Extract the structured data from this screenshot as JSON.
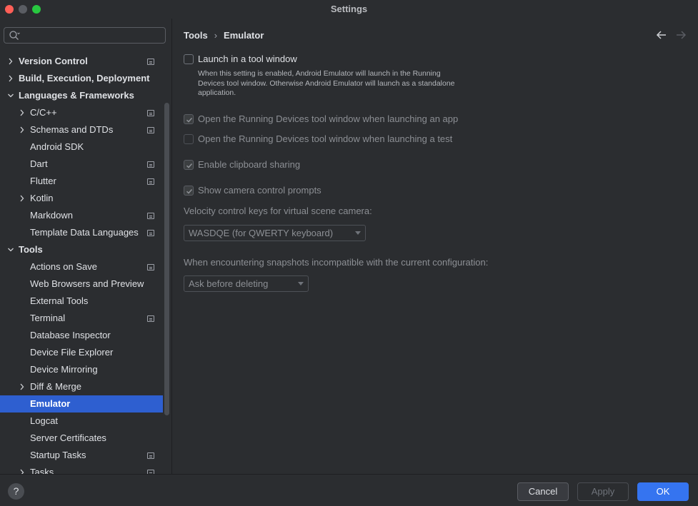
{
  "window": {
    "title": "Settings"
  },
  "search": {
    "placeholder": ""
  },
  "tree": [
    {
      "label": "Version Control",
      "level": 0,
      "chevron": "right",
      "proj": true
    },
    {
      "label": "Build, Execution, Deployment",
      "level": 0,
      "chevron": "right",
      "proj": false
    },
    {
      "label": "Languages & Frameworks",
      "level": 0,
      "chevron": "down",
      "proj": false
    },
    {
      "label": "C/C++",
      "level": 1,
      "chevron": "right",
      "proj": true
    },
    {
      "label": "Schemas and DTDs",
      "level": 1,
      "chevron": "right",
      "proj": true
    },
    {
      "label": "Android SDK",
      "level": 1,
      "chevron": "",
      "proj": false
    },
    {
      "label": "Dart",
      "level": 1,
      "chevron": "",
      "proj": true
    },
    {
      "label": "Flutter",
      "level": 1,
      "chevron": "",
      "proj": true
    },
    {
      "label": "Kotlin",
      "level": 1,
      "chevron": "right",
      "proj": false
    },
    {
      "label": "Markdown",
      "level": 1,
      "chevron": "",
      "proj": true
    },
    {
      "label": "Template Data Languages",
      "level": 1,
      "chevron": "",
      "proj": true
    },
    {
      "label": "Tools",
      "level": 0,
      "chevron": "down",
      "proj": false
    },
    {
      "label": "Actions on Save",
      "level": 1,
      "chevron": "",
      "proj": true
    },
    {
      "label": "Web Browsers and Preview",
      "level": 1,
      "chevron": "",
      "proj": false
    },
    {
      "label": "External Tools",
      "level": 1,
      "chevron": "",
      "proj": false
    },
    {
      "label": "Terminal",
      "level": 1,
      "chevron": "",
      "proj": true
    },
    {
      "label": "Database Inspector",
      "level": 1,
      "chevron": "",
      "proj": false
    },
    {
      "label": "Device File Explorer",
      "level": 1,
      "chevron": "",
      "proj": false
    },
    {
      "label": "Device Mirroring",
      "level": 1,
      "chevron": "",
      "proj": false
    },
    {
      "label": "Diff & Merge",
      "level": 1,
      "chevron": "right",
      "proj": false
    },
    {
      "label": "Emulator",
      "level": 1,
      "chevron": "",
      "proj": false,
      "selected": true
    },
    {
      "label": "Logcat",
      "level": 1,
      "chevron": "",
      "proj": false
    },
    {
      "label": "Server Certificates",
      "level": 1,
      "chevron": "",
      "proj": false
    },
    {
      "label": "Startup Tasks",
      "level": 1,
      "chevron": "",
      "proj": true
    },
    {
      "label": "Tasks",
      "level": 1,
      "chevron": "right",
      "proj": true
    }
  ],
  "breadcrumb": {
    "parent": "Tools",
    "separator": "›",
    "current": "Emulator"
  },
  "options": {
    "launch_tool_window": {
      "label": "Launch in a tool window",
      "checked": false
    },
    "launch_desc": "When this setting is enabled, Android Emulator will launch in the Running Devices tool window. Otherwise Android Emulator will launch as a standalone application.",
    "open_on_app": {
      "label": "Open the Running Devices tool window when launching an app",
      "checked": true
    },
    "open_on_test": {
      "label": "Open the Running Devices tool window when launching a test",
      "checked": false
    },
    "clipboard": {
      "label": "Enable clipboard sharing",
      "checked": true
    },
    "camera_prompts": {
      "label": "Show camera control prompts",
      "checked": true
    },
    "velocity_label": "Velocity control keys for virtual scene camera:",
    "velocity_value": "WASDQE (for QWERTY keyboard)",
    "snapshot_label": "When encountering snapshots incompatible with the current configuration:",
    "snapshot_value": "Ask before deleting"
  },
  "footer": {
    "help": "?",
    "cancel": "Cancel",
    "apply": "Apply",
    "ok": "OK"
  },
  "colors": {
    "accent": "#3574f0",
    "selection": "#2e5fd0",
    "background": "#2b2d30"
  }
}
